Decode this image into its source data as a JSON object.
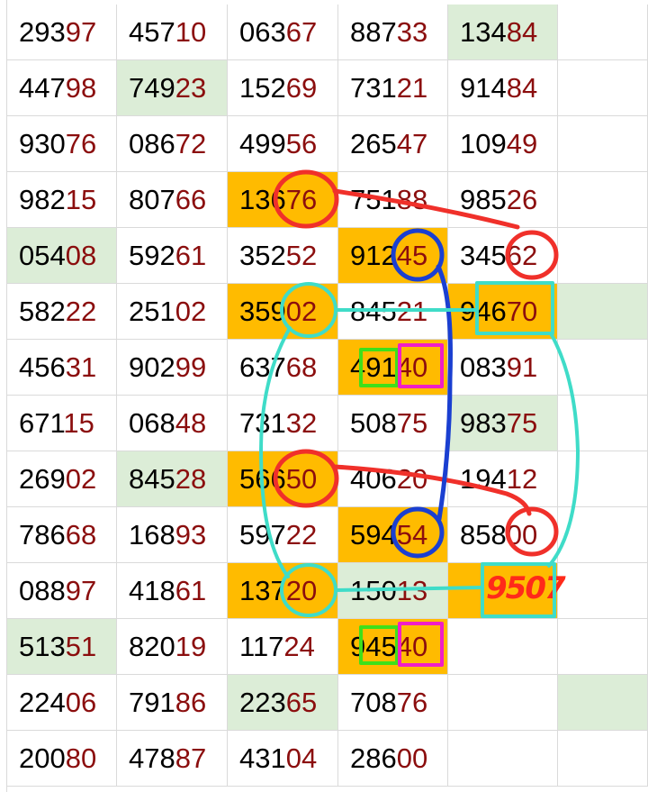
{
  "sheet": {
    "rows": [
      [
        {
          "a": "293",
          "b": "97"
        },
        {
          "a": "457",
          "b": "10"
        },
        {
          "a": "063",
          "b": "67"
        },
        {
          "a": "887",
          "b": "33"
        },
        {
          "a": "134",
          "b": "84",
          "bg": "green"
        },
        {
          "a": "",
          "b": ""
        }
      ],
      [
        {
          "a": "447",
          "b": "98"
        },
        {
          "a": "749",
          "b": "23",
          "bg": "green"
        },
        {
          "a": "152",
          "b": "69"
        },
        {
          "a": "731",
          "b": "21"
        },
        {
          "a": "914",
          "b": "84"
        },
        {
          "a": "",
          "b": ""
        }
      ],
      [
        {
          "a": "930",
          "b": "76"
        },
        {
          "a": "086",
          "b": "72"
        },
        {
          "a": "499",
          "b": "56"
        },
        {
          "a": "265",
          "b": "47"
        },
        {
          "a": "109",
          "b": "49"
        },
        {
          "a": "",
          "b": ""
        }
      ],
      [
        {
          "a": "982",
          "b": "15"
        },
        {
          "a": "807",
          "b": "66"
        },
        {
          "a": "136",
          "b": "76",
          "bg": "orange"
        },
        {
          "a": "751",
          "b": "88"
        },
        {
          "a": "985",
          "b": "26"
        },
        {
          "a": "",
          "b": ""
        }
      ],
      [
        {
          "a": "054",
          "b": "08",
          "bg": "green"
        },
        {
          "a": "592",
          "b": "61"
        },
        {
          "a": "352",
          "b": "52"
        },
        {
          "a": "912",
          "b": "45",
          "bg": "orange"
        },
        {
          "a": "345",
          "b": "62"
        },
        {
          "a": "",
          "b": ""
        }
      ],
      [
        {
          "a": "582",
          "b": "22"
        },
        {
          "a": "251",
          "b": "02"
        },
        {
          "a": "359",
          "b": "02",
          "bg": "orange"
        },
        {
          "a": "845",
          "b": "21"
        },
        {
          "a": "946",
          "b": "70",
          "bg": "orange"
        },
        {
          "a": "",
          "b": "",
          "bg": "green"
        }
      ],
      [
        {
          "a": "456",
          "b": "31"
        },
        {
          "a": "902",
          "b": "99"
        },
        {
          "a": "637",
          "b": "68"
        },
        {
          "a": "491",
          "b": "40",
          "bg": "orange"
        },
        {
          "a": "083",
          "b": "91"
        },
        {
          "a": "",
          "b": ""
        }
      ],
      [
        {
          "a": "671",
          "b": "15"
        },
        {
          "a": "068",
          "b": "48"
        },
        {
          "a": "731",
          "b": "32"
        },
        {
          "a": "508",
          "b": "75"
        },
        {
          "a": "983",
          "b": "75",
          "bg": "green"
        },
        {
          "a": "",
          "b": ""
        }
      ],
      [
        {
          "a": "269",
          "b": "02"
        },
        {
          "a": "845",
          "b": "28",
          "bg": "green"
        },
        {
          "a": "566",
          "b": "50",
          "bg": "orange"
        },
        {
          "a": "406",
          "b": "20"
        },
        {
          "a": "194",
          "b": "12"
        },
        {
          "a": "",
          "b": ""
        }
      ],
      [
        {
          "a": "786",
          "b": "68"
        },
        {
          "a": "168",
          "b": "93"
        },
        {
          "a": "597",
          "b": "22"
        },
        {
          "a": "594",
          "b": "54",
          "bg": "orange"
        },
        {
          "a": "858",
          "b": "00"
        },
        {
          "a": "",
          "b": ""
        }
      ],
      [
        {
          "a": "088",
          "b": "97"
        },
        {
          "a": "418",
          "b": "61"
        },
        {
          "a": "137",
          "b": "20",
          "bg": "orange"
        },
        {
          "a": "150",
          "b": "13",
          "bg": "green"
        },
        {
          "a": "",
          "b": "",
          "bg": "orange"
        },
        {
          "a": "",
          "b": ""
        }
      ],
      [
        {
          "a": "513",
          "b": "51",
          "bg": "green"
        },
        {
          "a": "820",
          "b": "19"
        },
        {
          "a": "117",
          "b": "24"
        },
        {
          "a": "945",
          "b": "40",
          "bg": "orange"
        },
        {
          "a": "",
          "b": ""
        },
        {
          "a": "",
          "b": ""
        }
      ],
      [
        {
          "a": "224",
          "b": "06"
        },
        {
          "a": "791",
          "b": "86"
        },
        {
          "a": "223",
          "b": "65",
          "bg": "green"
        },
        {
          "a": "708",
          "b": "76"
        },
        {
          "a": "",
          "b": ""
        },
        {
          "a": "",
          "b": "",
          "bg": "green"
        }
      ],
      [
        {
          "a": "200",
          "b": "80"
        },
        {
          "a": "478",
          "b": "87"
        },
        {
          "a": "431",
          "b": "04"
        },
        {
          "a": "286",
          "b": "00"
        },
        {
          "a": "",
          "b": ""
        },
        {
          "a": "",
          "b": ""
        }
      ]
    ]
  },
  "annotation": {
    "handwritten_number": "9507",
    "colors": {
      "red": "#f0302a",
      "blue": "#1a3fd1",
      "cyan": "#3fdcc8",
      "green": "#3fe01a",
      "magenta": "#f01ec8",
      "handwriting": "#ff2a1a"
    }
  },
  "colors": {
    "green_cell": "#dcedd7",
    "orange_cell": "#ffbb00",
    "digit_dark": "#000000",
    "digit_red": "#8b0e0e",
    "gridline": "#dadada"
  }
}
